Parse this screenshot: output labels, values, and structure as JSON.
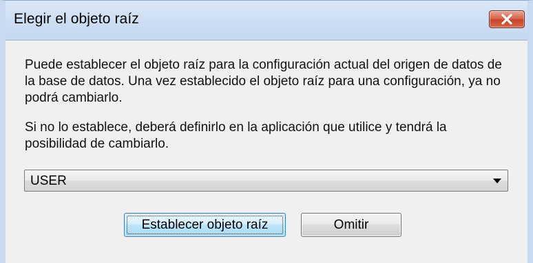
{
  "window": {
    "title": "Elegir el objeto raíz"
  },
  "body": {
    "paragraph1": "Puede establecer el objeto raíz para la configuración actual del origen de datos de la base de datos. Una vez establecido el objeto raíz para una configuración, ya no podrá cambiarlo.",
    "paragraph2": "Si no lo establece, deberá definirlo en la aplicación que utilice y tendrá la posibilidad de cambiarlo."
  },
  "root_object_select": {
    "selected_value": "USER"
  },
  "buttons": {
    "set_label": "Establecer objeto raíz",
    "skip_label": "Omitir"
  },
  "icons": {
    "close": "close-icon",
    "dropdown": "chevron-down-icon"
  },
  "colors": {
    "close_button": "#c7432a",
    "titlebar": "#cddff4",
    "primary_button_border": "#3c7fb1"
  }
}
